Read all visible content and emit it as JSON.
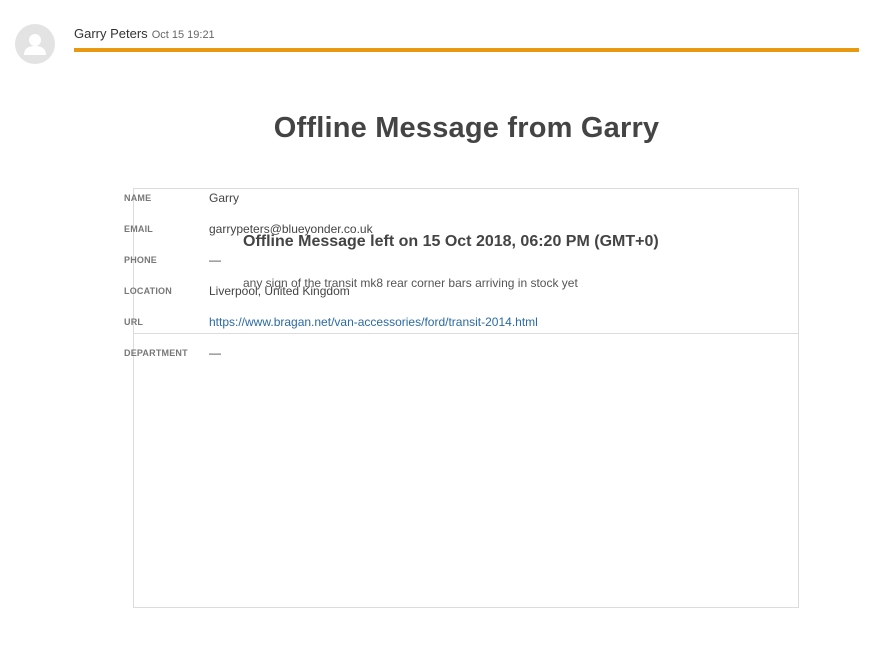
{
  "header": {
    "sender_name": "Garry Peters",
    "timestamp": "Oct 15 19:21",
    "accent_color": "#e8990f",
    "avatar_icon": "user-avatar-icon"
  },
  "email": {
    "title": "Offline Message from Garry",
    "offline_heading": "Offline Message left on 15 Oct 2018, 06:20 PM (GMT+0)",
    "offline_body": "any sign of the transit mk8 rear corner bars arriving in stock yet",
    "details": [
      {
        "label": "NAME",
        "value": "Garry"
      },
      {
        "label": "EMAIL",
        "value": "garrypeters@blueyonder.co.uk"
      },
      {
        "label": "PHONE",
        "value": "—"
      },
      {
        "label": "LOCATION",
        "value": "Liverpool, United Kingdom"
      },
      {
        "label": "URL",
        "value": "https://www.bragan.net/van-accessories/ford/transit-2014.html"
      },
      {
        "label": "DEPARTMENT",
        "value": "—"
      }
    ]
  }
}
